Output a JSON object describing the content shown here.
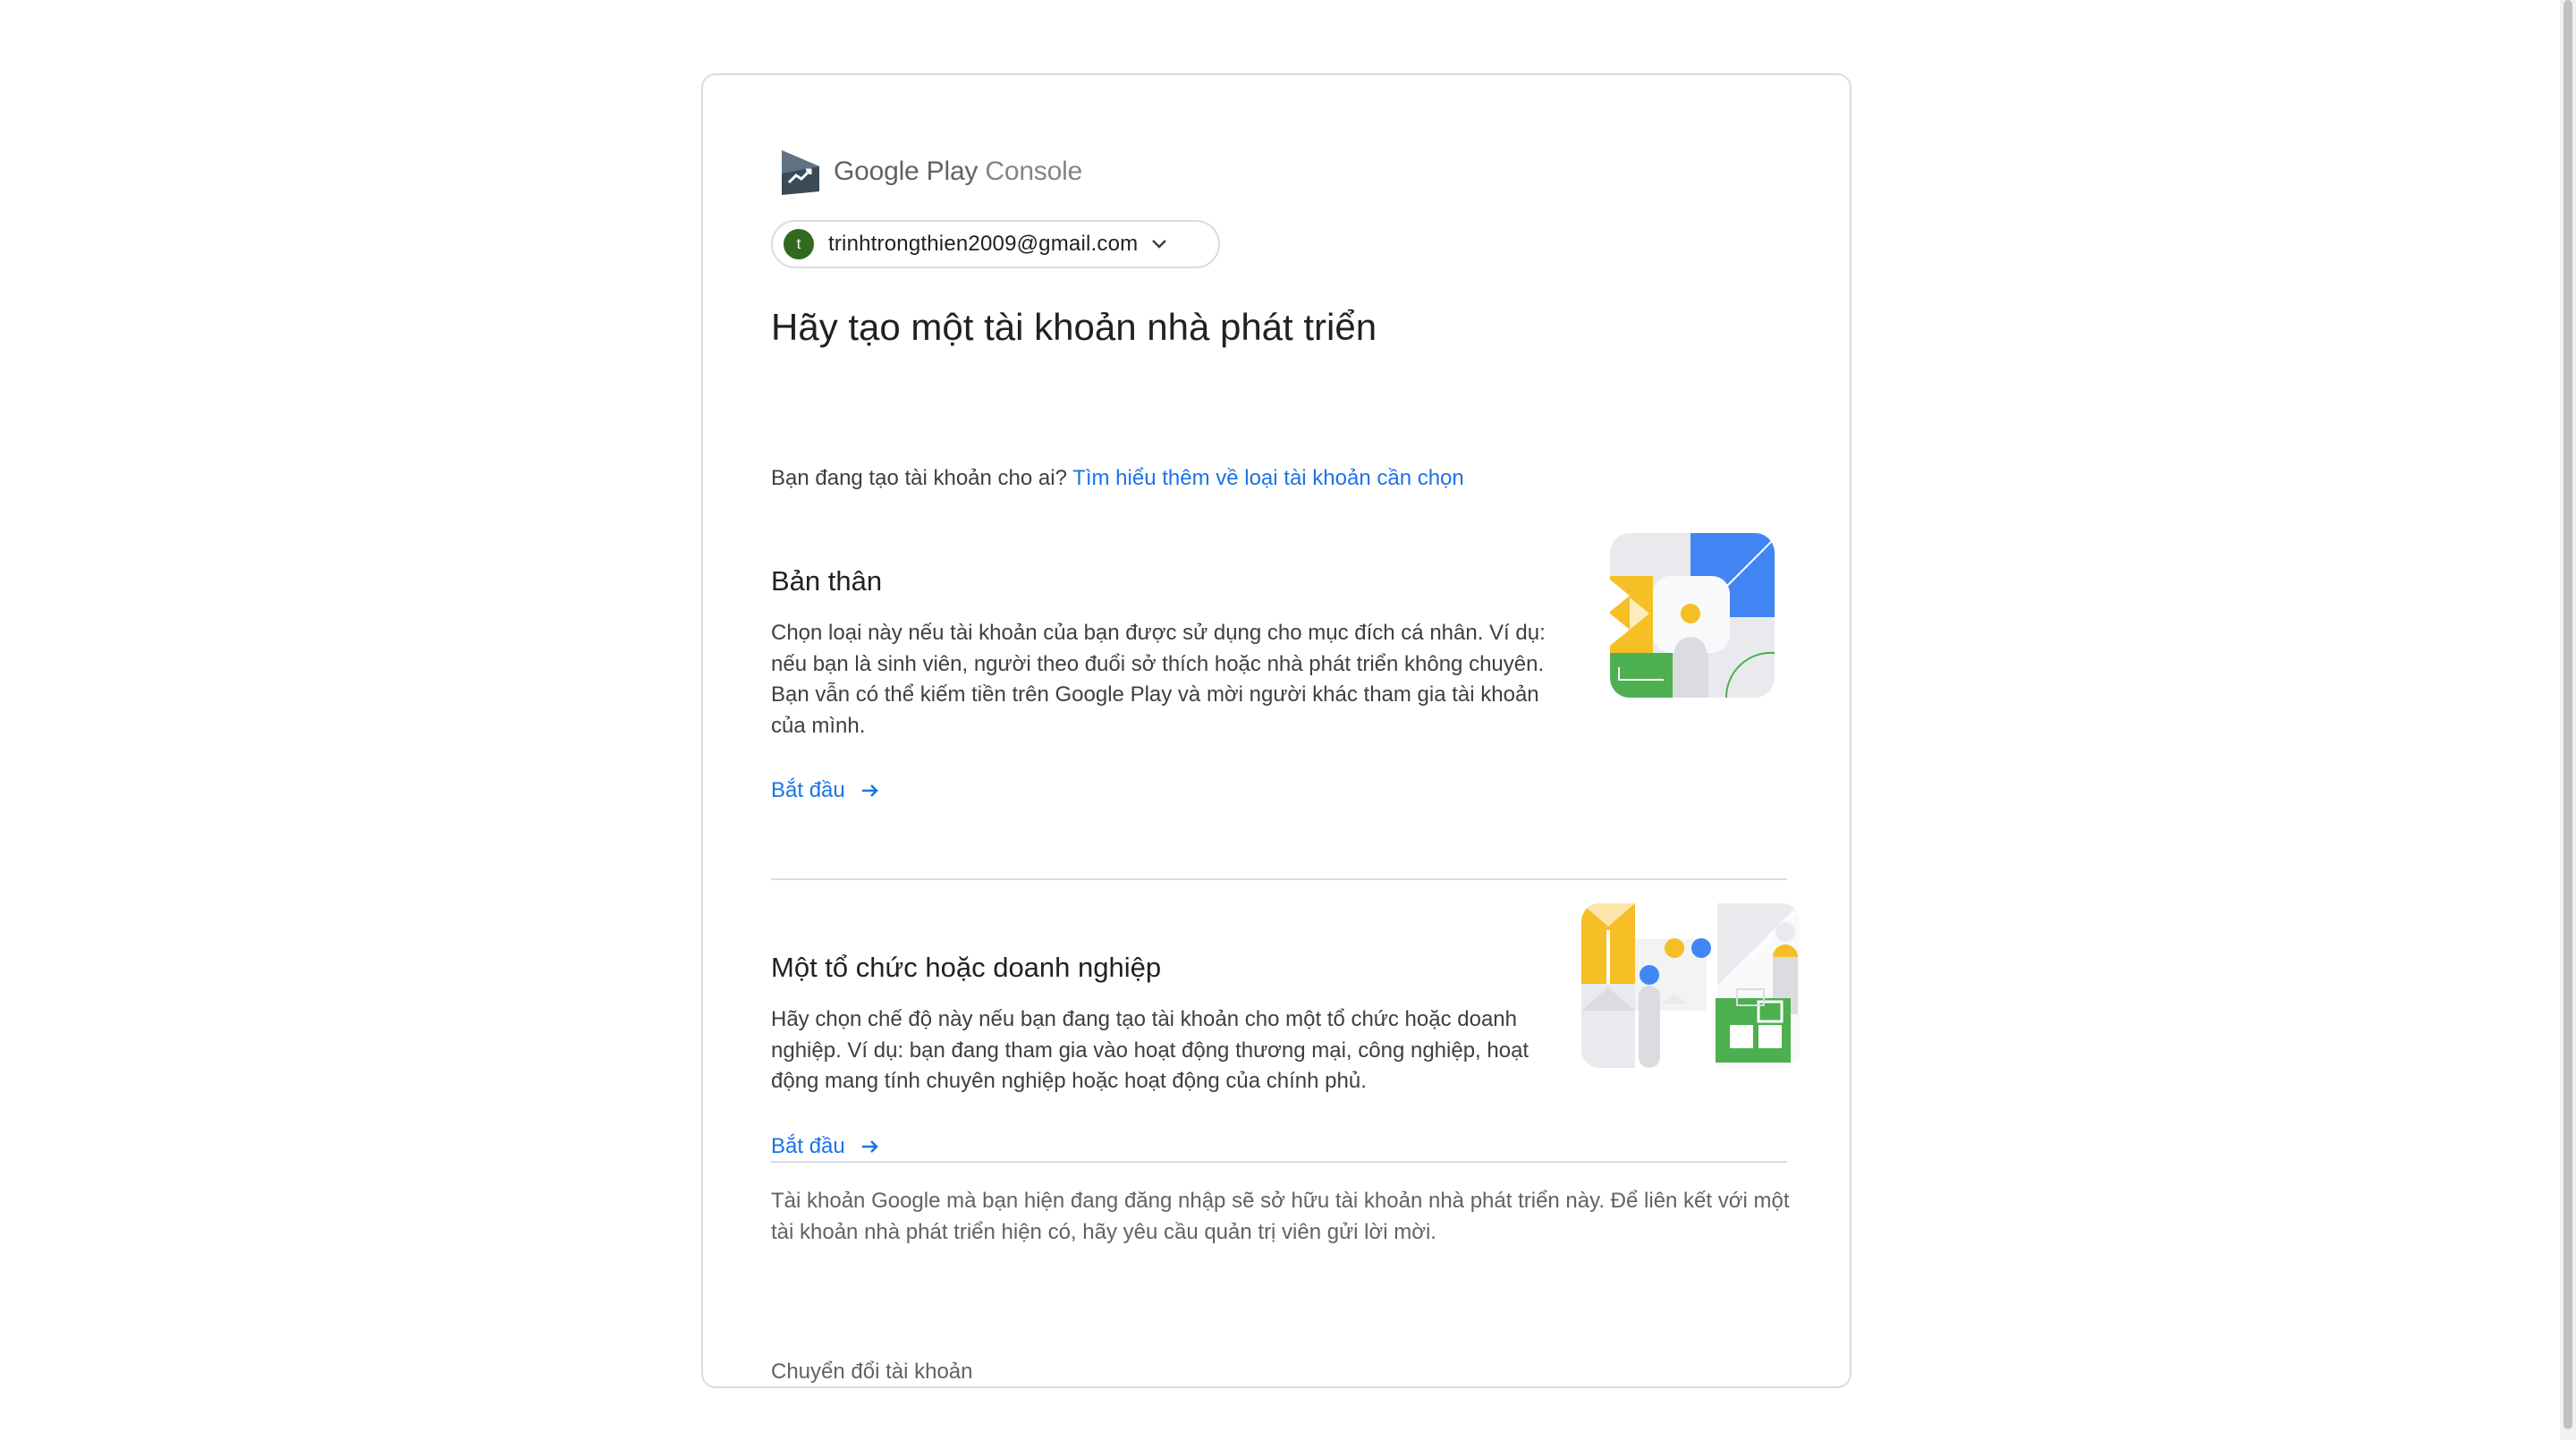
{
  "brand": {
    "google_play": "Google Play",
    "console": "Console"
  },
  "account": {
    "avatar_letter": "t",
    "email": "trinhtrongthien2009@gmail.com"
  },
  "page_title": "Hãy tạo một tài khoản nhà phát triển",
  "intro": {
    "question": "Bạn đang tạo tài khoản cho ai?",
    "link": "Tìm hiểu thêm về loại tài khoản cần chọn"
  },
  "options": [
    {
      "title": "Bản thân",
      "description": "Chọn loại này nếu tài khoản của bạn được sử dụng cho mục đích cá nhân. Ví dụ: nếu bạn là sinh viên, người theo đuổi sở thích hoặc nhà phát triển không chuyên. Bạn vẫn có thể kiếm tiền trên Google Play và mời người khác tham gia tài khoản của mình.",
      "cta": "Bắt đầu"
    },
    {
      "title": "Một tổ chức hoặc doanh nghiệp",
      "description": "Hãy chọn chế độ này nếu bạn đang tạo tài khoản cho một tổ chức hoặc doanh nghiệp. Ví dụ: bạn đang tham gia vào hoạt động thương mại, công nghiệp, hoạt động mang tính chuyên nghiệp hoặc hoạt động của chính phủ.",
      "cta": "Bắt đầu"
    }
  ],
  "footer": {
    "note": "Tài khoản Google mà bạn hiện đang đăng nhập sẽ sở hữu tài khoản nhà phát triển này. Để liên kết với một tài khoản nhà phát triển hiện có, hãy yêu cầu quản trị viên gửi lời mời.",
    "switch_account": "Chuyển đổi tài khoản"
  },
  "colors": {
    "link": "#1a73e8",
    "blue": "#4285f4",
    "yellow": "#f6bf26",
    "green": "#4caf50",
    "gray": "#e8eaed",
    "avatar": "#33691e"
  },
  "icons": [
    "google-play-console-logo-icon",
    "chevron-down-icon",
    "arrow-right-icon"
  ]
}
